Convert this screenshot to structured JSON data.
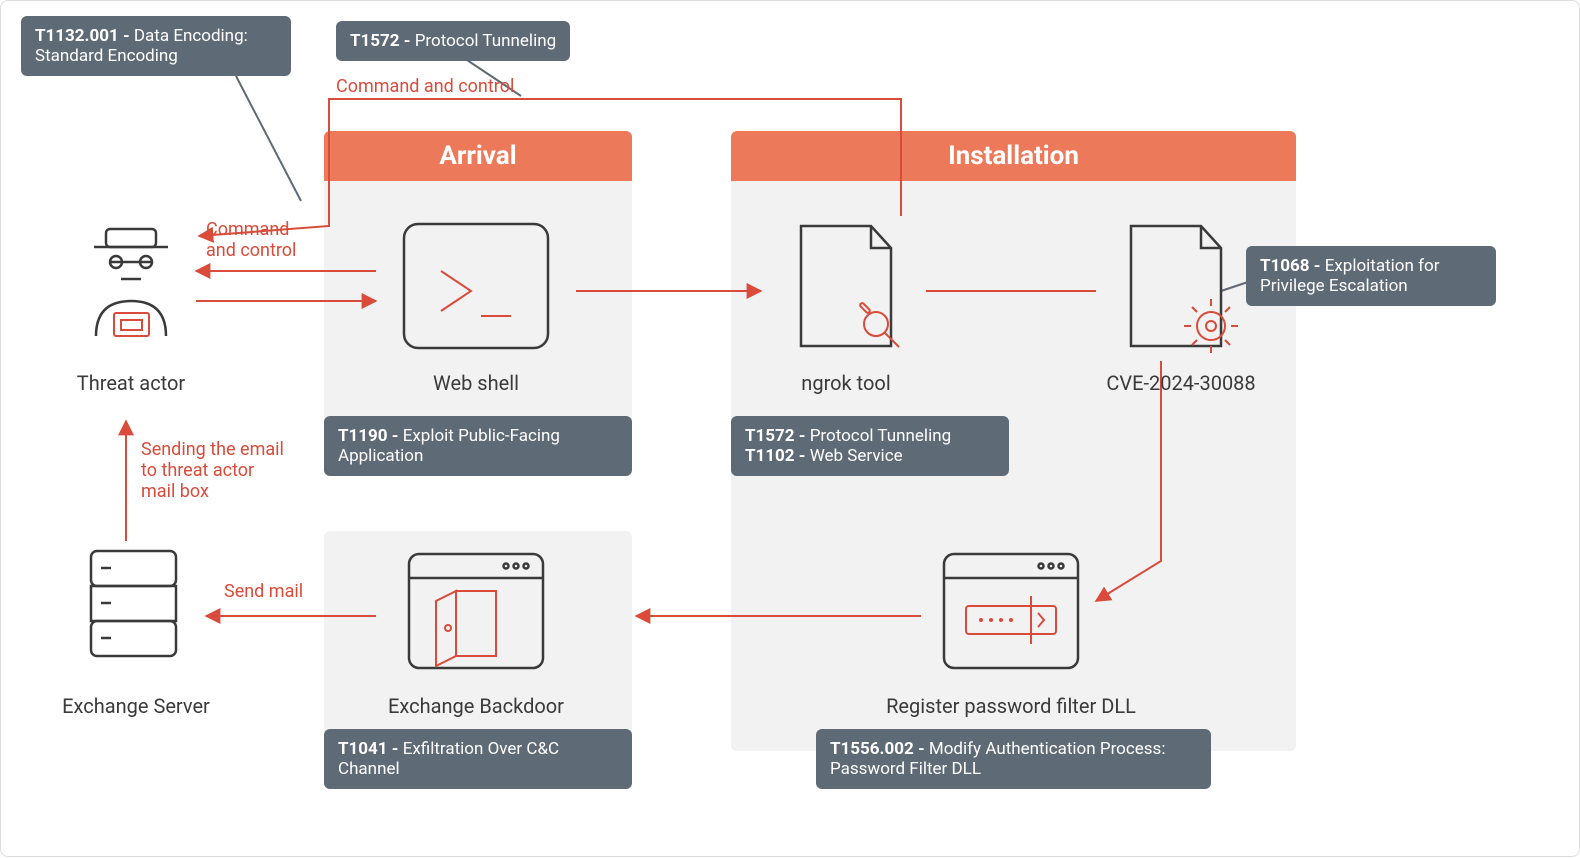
{
  "panels": {
    "arrival": {
      "title": "Arrival",
      "webshell": "Web shell",
      "t1190": "T1190 - Exploit Public-Facing Application",
      "exchangeBackdoor": "Exchange Backdoor",
      "t1041": "T1041 - Exfiltration Over C&C Channel"
    },
    "installation": {
      "title": "Installation",
      "ngrok": "ngrok tool",
      "cve": "CVE-2024-30088",
      "t1572": "T1572 - Protocol Tunneling",
      "t1102": "T1102 - Web Service",
      "t1068": "T1068 - Exploitation for Privilege Escalation",
      "passwordFilter": "Register password filter DLL",
      "t1556": "T1556.002 - Modify Authentication Process: Password Filter DLL"
    }
  },
  "left": {
    "threatActor": "Threat actor",
    "exchangeServer": "Exchange Server",
    "sendMail": "Send mail",
    "sendingEmail": "Sending the email to threat actor mail box",
    "cmdControl1": "Command and control",
    "cmdControl2": "Command and control",
    "t1132": "T1132.001 - Data Encoding: Standard Encoding",
    "t1572top": "T1572 - Protocol Tunneling"
  }
}
